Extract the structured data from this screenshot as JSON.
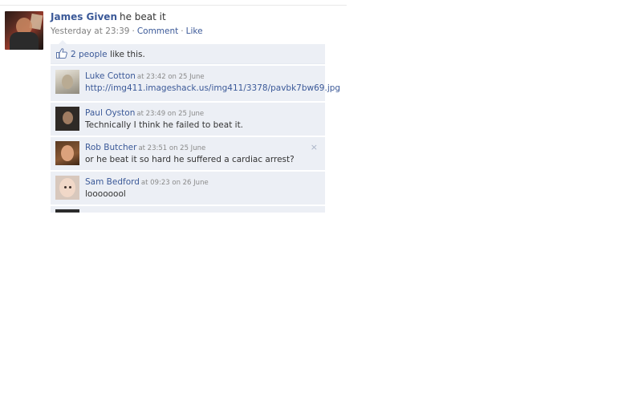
{
  "post": {
    "author": "James Given",
    "status": "he beat it",
    "timestamp": "Yesterday at 23:39",
    "separator": "·",
    "comment_link": "Comment",
    "like_link": "Like"
  },
  "likes": {
    "count_label": "2 people",
    "suffix": "like this."
  },
  "comments": [
    {
      "name": "Luke Cotton",
      "time": "at 23:42 on 25 June",
      "text": "http://img411.imageshack.us/img411/3378/pavbk7bw69.jpg"
    },
    {
      "name": "Paul Oyston",
      "time": "at 23:49 on 25 June",
      "text": "Technically I think he failed to beat it."
    },
    {
      "name": "Rob Butcher",
      "time": "at 23:51 on 25 June",
      "text": "or he beat it so hard he suffered a cardiac arrest?"
    },
    {
      "name": "Sam Bedford",
      "time": "at 09:23 on 26 June",
      "text": "loooooool"
    }
  ],
  "icons": {
    "like": "thumbs-up-icon",
    "delete": "close-icon"
  },
  "delete_glyph": "×",
  "colors": {
    "link": "#3b5998",
    "panel": "#eceff5",
    "muted": "#808080"
  }
}
